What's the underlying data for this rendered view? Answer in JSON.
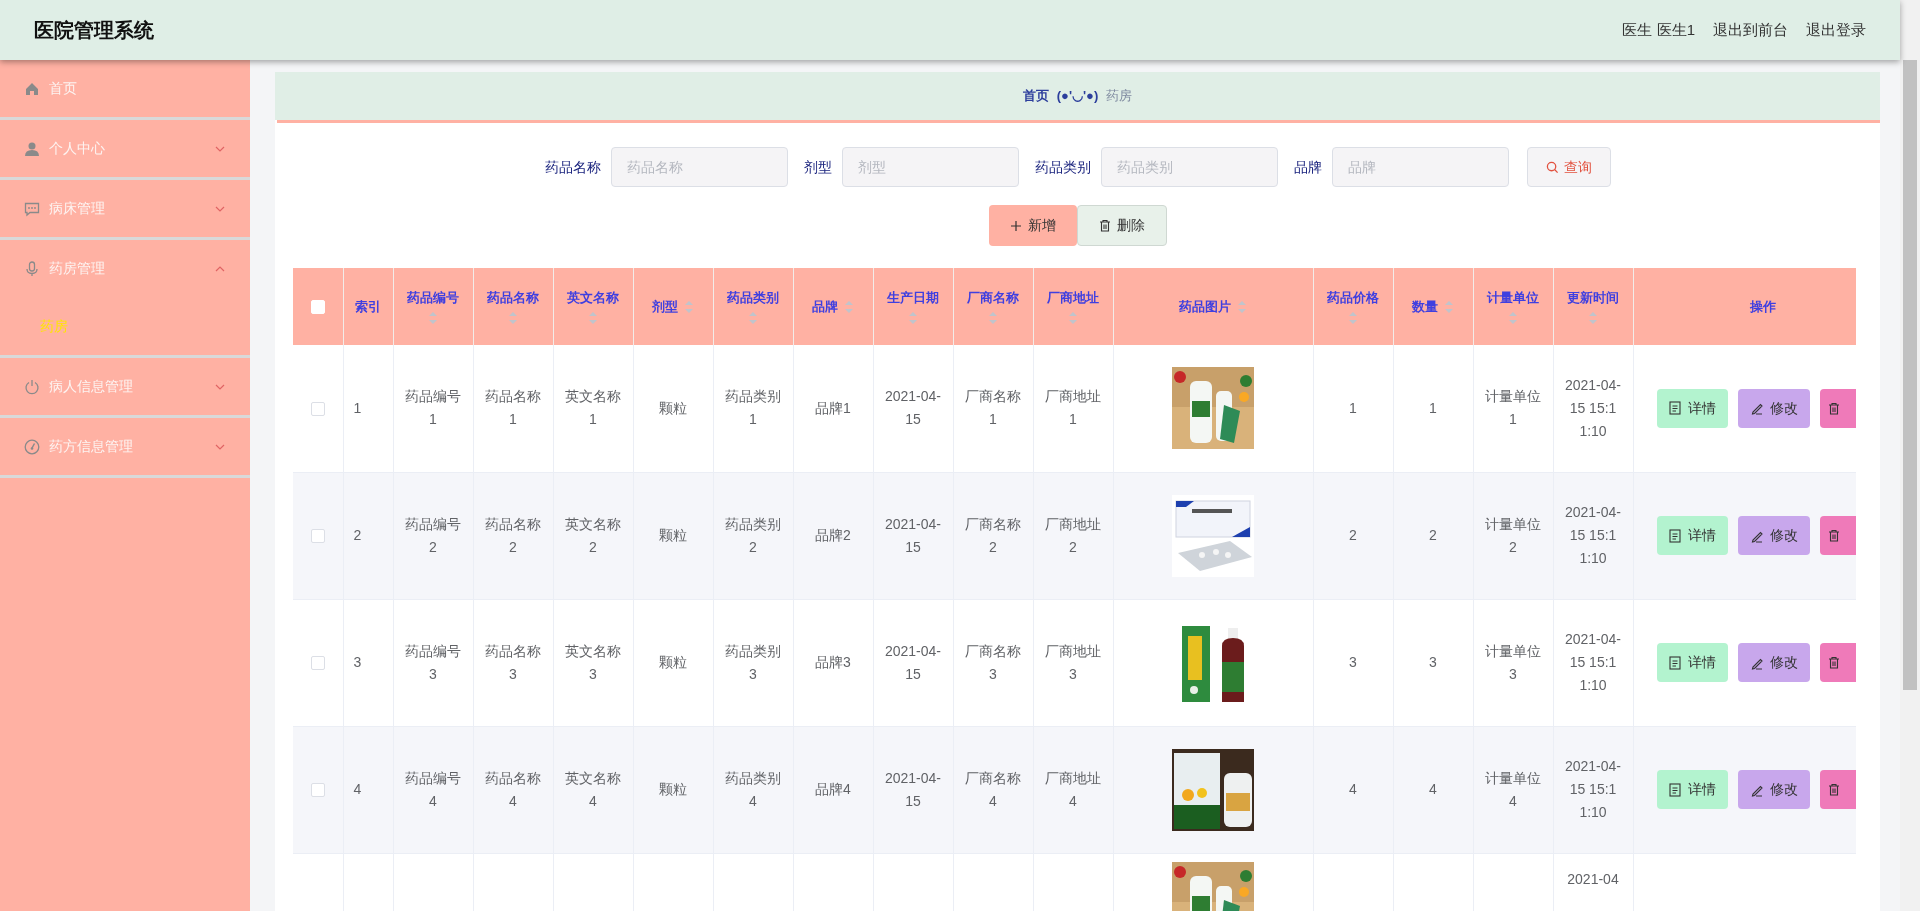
{
  "header": {
    "title": "医院管理系统",
    "user": "医生 医生1",
    "links": [
      "退出到前台",
      "退出登录"
    ]
  },
  "sidebar": {
    "items": [
      {
        "label": "首页",
        "expandable": false
      },
      {
        "label": "个人中心",
        "expandable": true,
        "expanded": false
      },
      {
        "label": "病床管理",
        "expandable": true,
        "expanded": false
      },
      {
        "label": "药房管理",
        "expandable": true,
        "expanded": true,
        "children": [
          {
            "label": "药房",
            "selected": true
          }
        ]
      },
      {
        "label": "病人信息管理",
        "expandable": true,
        "expanded": false
      },
      {
        "label": "药方信息管理",
        "expandable": true,
        "expanded": false
      }
    ]
  },
  "breadcrumb": {
    "home": "首页",
    "separator": "(●'◡'●)",
    "current": "药房"
  },
  "search": {
    "fields": [
      {
        "label": "药品名称",
        "placeholder": "药品名称"
      },
      {
        "label": "剂型",
        "placeholder": "剂型"
      },
      {
        "label": "药品类别",
        "placeholder": "药品类别"
      },
      {
        "label": "品牌",
        "placeholder": "品牌"
      }
    ],
    "button": "查询"
  },
  "actions": [
    "新增",
    "删除"
  ],
  "table": {
    "select_all_checked": false,
    "columns": [
      {
        "label": "索引",
        "sortable": false
      },
      {
        "label": "药品编号",
        "sortable": true
      },
      {
        "label": "药品名称",
        "sortable": true
      },
      {
        "label": "英文名称",
        "sortable": true
      },
      {
        "label": "剂型",
        "sortable": true
      },
      {
        "label": "药品类别",
        "sortable": true
      },
      {
        "label": "品牌",
        "sortable": true
      },
      {
        "label": "生产日期",
        "sortable": true
      },
      {
        "label": "厂商名称",
        "sortable": true
      },
      {
        "label": "厂商地址",
        "sortable": true
      },
      {
        "label": "药品图片",
        "sortable": true
      },
      {
        "label": "药品价格",
        "sortable": true
      },
      {
        "label": "数量",
        "sortable": true
      },
      {
        "label": "计量单位",
        "sortable": true
      },
      {
        "label": "更新时间",
        "sortable": true
      },
      {
        "label": "操作",
        "sortable": false
      }
    ],
    "rows": [
      {
        "checked": false,
        "cells": [
          "1",
          "药品编号1",
          "药品名称1",
          "英文名称1",
          "颗粒",
          "药品类别1",
          "品牌1",
          "2021-04-15",
          "厂商名称1",
          "厂商地址1",
          {
            "kind": "picture"
          },
          "1",
          "1",
          "计量单位1",
          "2021-04-15 15:11:10"
        ],
        "buttons": [
          "详情",
          "修改"
        ]
      },
      {
        "checked": false,
        "cells": [
          "2",
          "药品编号2",
          "药品名称2",
          "英文名称2",
          "颗粒",
          "药品类别2",
          "品牌2",
          "2021-04-15",
          "厂商名称2",
          "厂商地址2",
          {
            "kind": "picture"
          },
          "2",
          "2",
          "计量单位2",
          "2021-04-15 15:11:10"
        ],
        "buttons": [
          "详情",
          "修改"
        ]
      },
      {
        "checked": false,
        "cells": [
          "3",
          "药品编号3",
          "药品名称3",
          "英文名称3",
          "颗粒",
          "药品类别3",
          "品牌3",
          "2021-04-15",
          "厂商名称3",
          "厂商地址3",
          {
            "kind": "picture"
          },
          "3",
          "3",
          "计量单位3",
          "2021-04-15 15:11:10"
        ],
        "buttons": [
          "详情",
          "修改"
        ]
      },
      {
        "checked": false,
        "cells": [
          "4",
          "药品编号4",
          "药品名称4",
          "英文名称4",
          "颗粒",
          "药品类别4",
          "品牌4",
          "2021-04-15",
          "厂商名称4",
          "厂商地址4",
          {
            "kind": "picture"
          },
          "4",
          "4",
          "计量单位4",
          "2021-04-15 15:11:10"
        ],
        "buttons": [
          "详情",
          "修改"
        ]
      },
      {
        "cells": [
          "",
          "",
          "",
          "",
          "",
          "",
          "",
          "",
          "",
          "",
          {
            "kind": "picture"
          },
          "",
          "",
          "",
          "2021-04"
        ]
      }
    ]
  }
}
